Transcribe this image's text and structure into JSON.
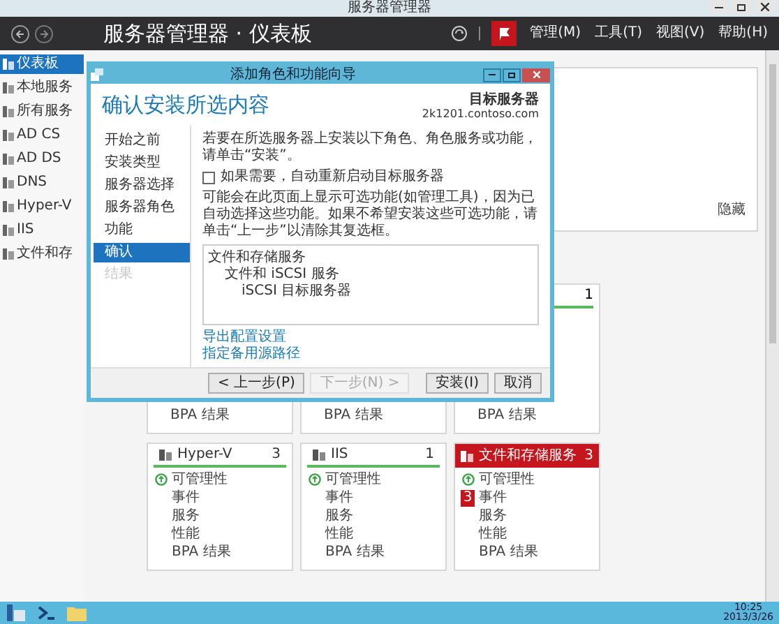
{
  "window": {
    "title": "服务器管理器"
  },
  "header": {
    "breadcrumb": "服务器管理器 · 仪表板",
    "menus": [
      "管理(M)",
      "工具(T)",
      "视图(V)",
      "帮助(H)"
    ]
  },
  "sidebar": {
    "items": [
      {
        "label": "仪表板",
        "selected": true
      },
      {
        "label": "本地服务",
        "selected": false
      },
      {
        "label": "所有服务",
        "selected": false
      },
      {
        "label": "AD CS",
        "selected": false
      },
      {
        "label": "AD DS",
        "selected": false
      },
      {
        "label": "DNS",
        "selected": false
      },
      {
        "label": "Hyper-V",
        "selected": false
      },
      {
        "label": "IIS",
        "selected": false
      },
      {
        "label": "文件和存",
        "selected": false
      }
    ]
  },
  "top_panel": {
    "hide_link": "隐藏"
  },
  "tiles_row1": [
    {
      "lines": [
        "BPA 结果"
      ]
    },
    {
      "lines": [
        "BPA 结果"
      ]
    },
    {
      "count": "1",
      "lines": [
        "BPA 结果"
      ]
    }
  ],
  "tiles_row2": [
    {
      "name": "Hyper-V",
      "count": "3",
      "alert": false,
      "rows": [
        {
          "label": "可管理性",
          "kind": "ok"
        },
        {
          "label": "事件",
          "kind": "plain"
        },
        {
          "label": "服务",
          "kind": "plain"
        },
        {
          "label": "性能",
          "kind": "plain"
        },
        {
          "label": "BPA 结果",
          "kind": "plain"
        }
      ]
    },
    {
      "name": "IIS",
      "count": "1",
      "alert": false,
      "rows": [
        {
          "label": "可管理性",
          "kind": "ok"
        },
        {
          "label": "事件",
          "kind": "plain"
        },
        {
          "label": "服务",
          "kind": "plain"
        },
        {
          "label": "性能",
          "kind": "plain"
        },
        {
          "label": "BPA 结果",
          "kind": "plain"
        }
      ]
    },
    {
      "name": "文件和存储服务",
      "count": "3",
      "alert": true,
      "rows": [
        {
          "label": "可管理性",
          "kind": "ok"
        },
        {
          "label": "事件",
          "kind": "badge",
          "badge": "3"
        },
        {
          "label": "服务",
          "kind": "plain"
        },
        {
          "label": "性能",
          "kind": "plain"
        },
        {
          "label": "BPA 结果",
          "kind": "plain"
        }
      ]
    }
  ],
  "dialog": {
    "title": "添加角色和功能向导",
    "heading": "确认安装所选内容",
    "target_label": "目标服务器",
    "target_server": "2k1201.contoso.com",
    "steps": [
      {
        "label": "开始之前",
        "selected": false,
        "disabled": false
      },
      {
        "label": "安装类型",
        "selected": false,
        "disabled": false
      },
      {
        "label": "服务器选择",
        "selected": false,
        "disabled": false
      },
      {
        "label": "服务器角色",
        "selected": false,
        "disabled": false
      },
      {
        "label": "功能",
        "selected": false,
        "disabled": false
      },
      {
        "label": "确认",
        "selected": true,
        "disabled": false
      },
      {
        "label": "结果",
        "selected": false,
        "disabled": true
      }
    ],
    "intro": "若要在所选服务器上安装以下角色、角色服务或功能，请单击“安装”。",
    "restart_option": {
      "label": "如果需要，自动重新启动目标服务器",
      "checked": false
    },
    "note": "可能会在此页面上显示可选功能(如管理工具)，因为已自动选择这些功能。如果不希望安装这些可选功能，请单击“上一步”以清除其复选框。",
    "selection": [
      {
        "label": "文件和存储服务",
        "children": [
          {
            "label": "文件和 iSCSI 服务",
            "children": [
              {
                "label": "iSCSI 目标服务器"
              }
            ]
          }
        ]
      }
    ],
    "links": [
      "导出配置设置",
      "指定备用源路径"
    ],
    "buttons": [
      {
        "label": "< 上一步(P)",
        "disabled": false
      },
      {
        "label": "下一步(N) >",
        "disabled": true
      },
      {
        "label": "安装(I)",
        "disabled": false
      },
      {
        "label": "取消",
        "disabled": false
      }
    ]
  },
  "taskbar": {
    "time": "10:25",
    "date": "2013/3/26"
  }
}
